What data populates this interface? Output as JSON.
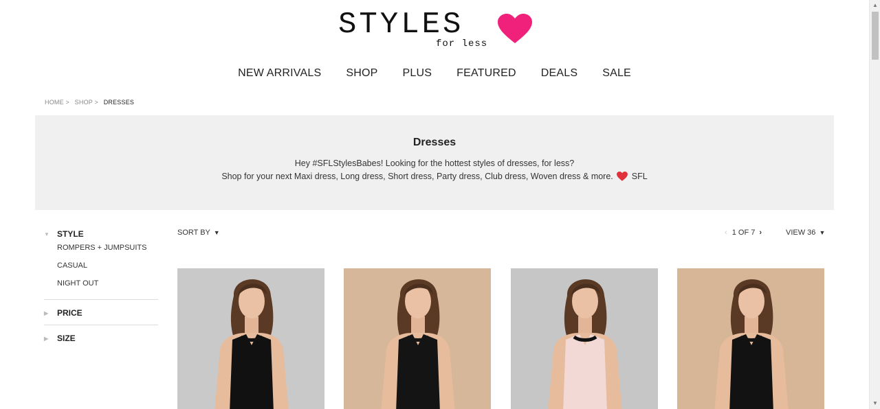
{
  "logo": {
    "word": "STYLES",
    "sub": "for less",
    "heart_color": "#f0217a"
  },
  "nav": [
    "NEW ARRIVALS",
    "SHOP",
    "PLUS",
    "FEATURED",
    "DEALS",
    "SALE"
  ],
  "breadcrumb": [
    "HOME >",
    "SHOP >",
    "DRESSES"
  ],
  "hero": {
    "title": "Dresses",
    "line1": "Hey #SFLStylesBabes! Looking for the hottest styles of dresses, for less?",
    "line2_before": "Shop for your next Maxi dress, Long dress, Short dress, Party dress, Club dress, Woven dress & more.",
    "line2_after": "SFL"
  },
  "filters": {
    "style_label": "STYLE",
    "style_items": [
      "ROMPERS + JUMPSUITS",
      "CASUAL",
      "NIGHT OUT"
    ],
    "price_label": "PRICE",
    "size_label": "SIZE"
  },
  "toolbar": {
    "sort_label": "SORT BY",
    "pager_prev": "‹",
    "pager_text": "1 OF 7",
    "pager_next": "›",
    "view_label": "VIEW 36"
  },
  "products": [
    {
      "bg": "#c9c9c9",
      "dress": "#111111",
      "trim": "#111111"
    },
    {
      "bg": "#d6b79a",
      "dress": "#141414",
      "trim": "#141414"
    },
    {
      "bg": "#c6c6c6",
      "dress": "#f3d9d6",
      "trim": "#111111"
    },
    {
      "bg": "#d7b597",
      "dress": "#121212",
      "trim": "#121212"
    }
  ],
  "colors": {
    "accent": "#f0217a",
    "hero_bg": "#f0f0f0"
  }
}
